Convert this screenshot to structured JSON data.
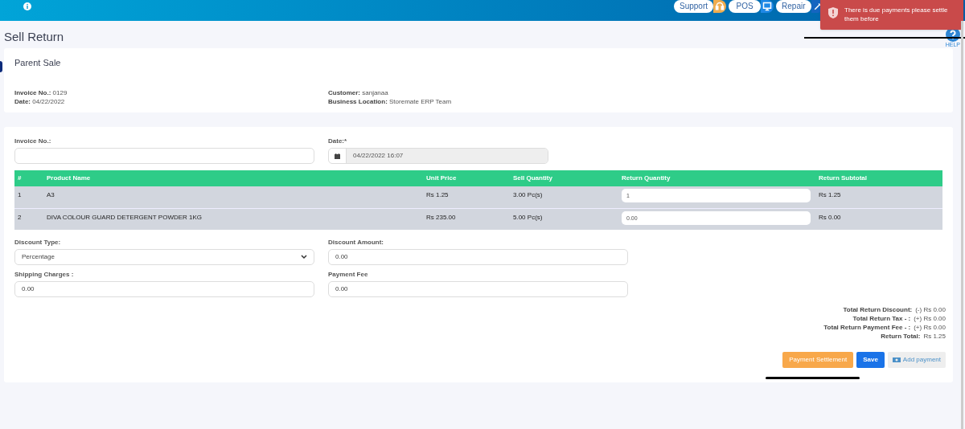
{
  "header": {
    "buttons": [
      {
        "label": "Support",
        "kind": "support"
      },
      {
        "label": "POS",
        "kind": "pos"
      },
      {
        "label": "Repair",
        "kind": "repair"
      }
    ]
  },
  "toast": {
    "message": "There is due payments please settle them before"
  },
  "page_title": "Sell Return",
  "help": {
    "label": "HELP"
  },
  "parent_sale": {
    "title": "Parent Sale",
    "fields": [
      {
        "label": "Invoice No.:",
        "value": "0129"
      },
      {
        "label": "Date:",
        "value": "04/22/2022"
      },
      {
        "label": "Customer:",
        "value": "sanjanaa"
      },
      {
        "label": "Business Location:",
        "value": "Storemate ERP Team"
      }
    ]
  },
  "form": {
    "invoice_no": {
      "label": "Invoice No.:"
    },
    "date": {
      "label": "Date:*",
      "value": "04/22/2022 16:07"
    }
  },
  "table": {
    "columns": [
      "#",
      "Product Name",
      "Unit Price",
      "Sell Quantity",
      "Return Quantity",
      "Return Subtotal"
    ],
    "rows": [
      {
        "index": "1",
        "product": "A3",
        "unit_price": "Rs 1.25",
        "sell_quantity": "3.00 Pc(s)",
        "return_quantity": "1",
        "subtotal": "Rs 1.25"
      },
      {
        "index": "2",
        "product": "DIVA COLOUR GUARD DETERGENT POWDER 1KG",
        "unit_price": "Rs 235.00",
        "sell_quantity": "5.00 Pc(s)",
        "return_quantity": "0.00",
        "subtotal": "Rs 0.00"
      }
    ]
  },
  "fields": [
    {
      "label": "Discount Type:",
      "value": "Percentage",
      "kind": "select"
    },
    {
      "label": "Discount Amount:",
      "value": "0.00",
      "kind": "input"
    },
    {
      "label": "Shipping Charges :",
      "value": "0.00",
      "kind": "input"
    },
    {
      "label": "Payment Fee",
      "value": "0.00",
      "kind": "input"
    }
  ],
  "totals": [
    {
      "label": "Total Return Discount:",
      "value": "(-) Rs 0.00"
    },
    {
      "label": "Total Return Tax - :",
      "value": "(+) Rs 0.00"
    },
    {
      "label": "Total Return Payment Fee - :",
      "value": "(+) Rs 0.00"
    },
    {
      "label": "Return Total:",
      "value": "Rs 1.25"
    }
  ],
  "actions": [
    {
      "label": "Payment Settlement",
      "kind": "warning"
    },
    {
      "label": "Save",
      "kind": "primary"
    },
    {
      "label": "Add payment",
      "kind": "plain"
    }
  ]
}
